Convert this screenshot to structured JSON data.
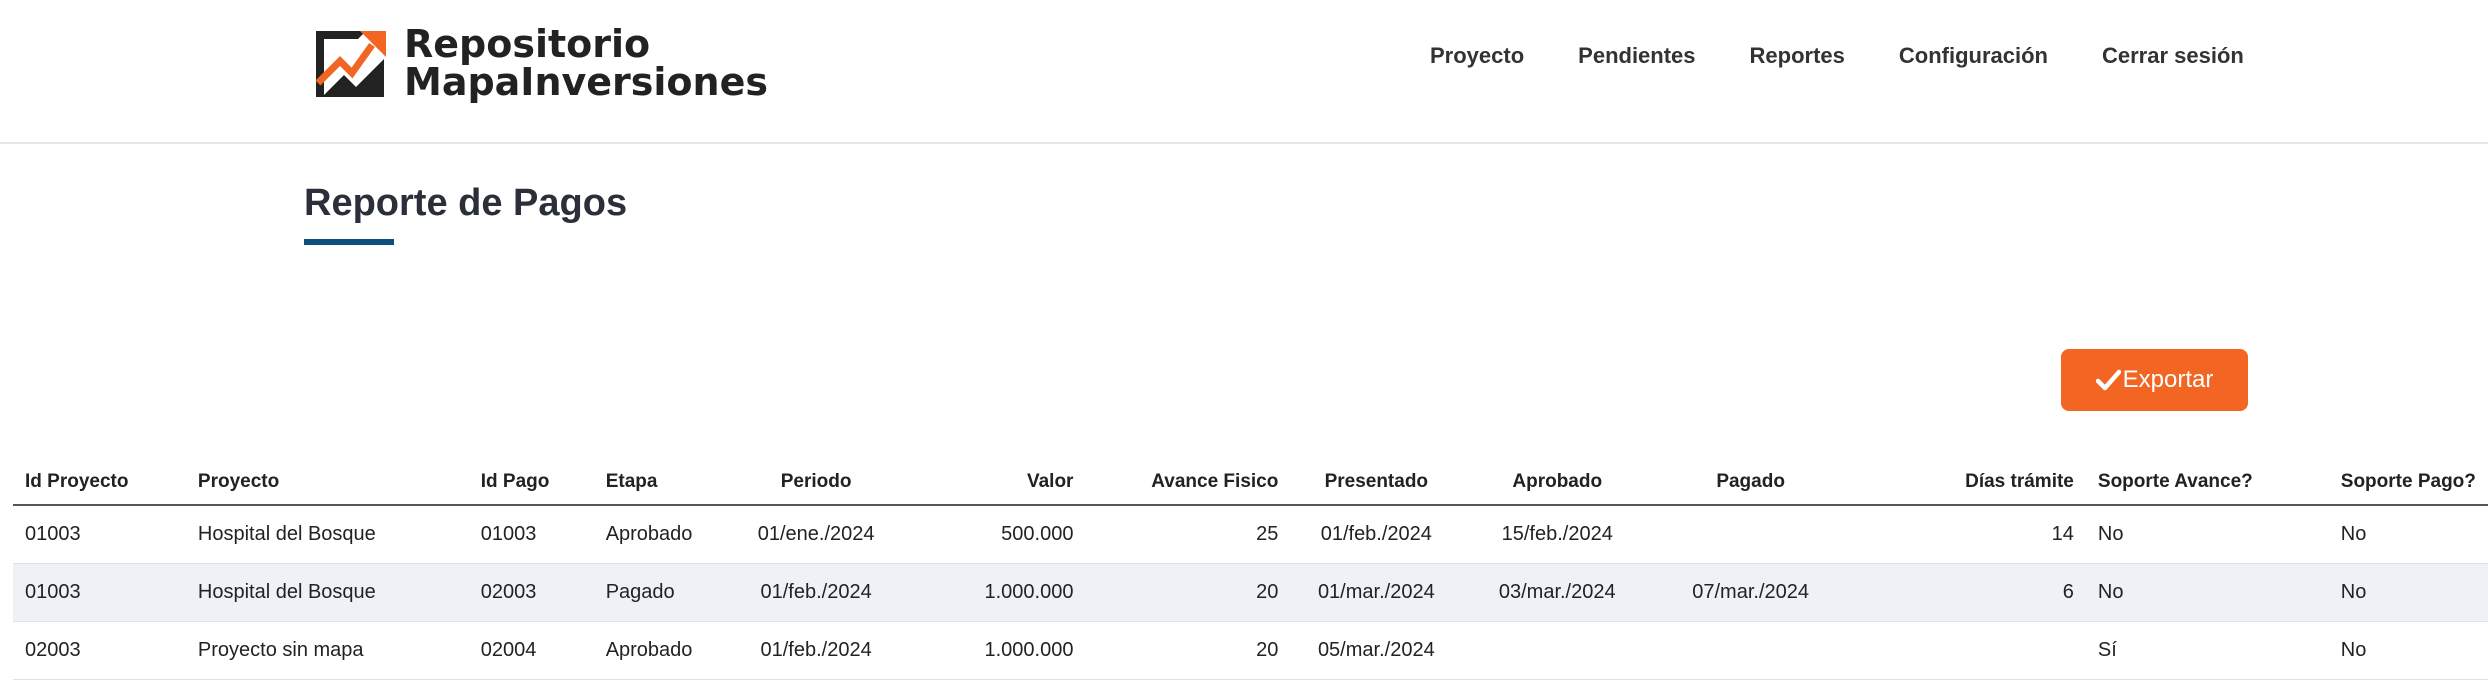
{
  "header": {
    "logo_line1": "Repositorio",
    "logo_line2": "MapaInversiones",
    "nav": [
      "Proyecto",
      "Pendientes",
      "Reportes",
      "Configuración",
      "Cerrar sesión"
    ]
  },
  "page": {
    "title": "Reporte de Pagos",
    "export_label": "Exportar"
  },
  "colors": {
    "accent": "#f26522",
    "title_underline": "#0d4e7e",
    "logo_dark": "#222222"
  },
  "table": {
    "columns": [
      "Id Proyecto",
      "Proyecto",
      "Id Pago",
      "Etapa",
      "Periodo",
      "Valor",
      "Avance Fisico",
      "Presentado",
      "Aprobado",
      "Pagado",
      "Días trámite",
      "Soporte Avance?",
      "Soporte Pago?"
    ],
    "rows": [
      [
        "01003",
        "Hospital del Bosque",
        "01003",
        "Aprobado",
        "01/ene./2024",
        "500.000",
        "25",
        "01/feb./2024",
        "15/feb./2024",
        "",
        "14",
        "No",
        "No"
      ],
      [
        "01003",
        "Hospital del Bosque",
        "02003",
        "Pagado",
        "01/feb./2024",
        "1.000.000",
        "20",
        "01/mar./2024",
        "03/mar./2024",
        "07/mar./2024",
        "6",
        "No",
        "No"
      ],
      [
        "02003",
        "Proyecto sin mapa",
        "02004",
        "Aprobado",
        "01/feb./2024",
        "1.000.000",
        "20",
        "05/mar./2024",
        "",
        "",
        "",
        "Sí",
        "No"
      ]
    ]
  }
}
